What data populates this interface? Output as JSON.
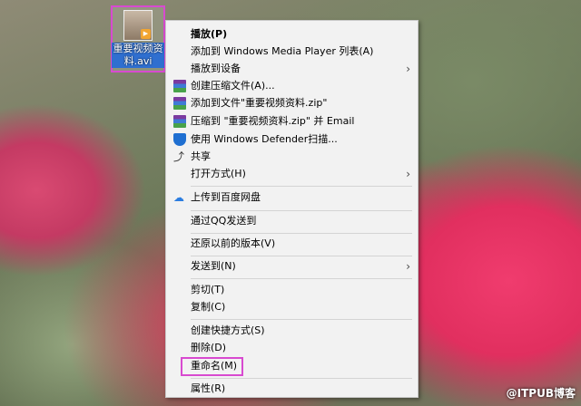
{
  "desktop_file": {
    "label": "重要视频资料.avi"
  },
  "context_menu": {
    "items": [
      {
        "label": "播放(P)"
      },
      {
        "label": "添加到 Windows Media Player 列表(A)"
      },
      {
        "label": "播放到设备"
      },
      {
        "label": "创建压缩文件(A)..."
      },
      {
        "label": "添加到文件\"重要视频资料.zip\""
      },
      {
        "label": "压缩到 \"重要视频资料.zip\" 并 Email"
      },
      {
        "label": "使用 Windows Defender扫描..."
      },
      {
        "label": "共享"
      },
      {
        "label": "打开方式(H)"
      },
      {
        "label": "上传到百度网盘"
      },
      {
        "label": "通过QQ发送到"
      },
      {
        "label": "还原以前的版本(V)"
      },
      {
        "label": "发送到(N)"
      },
      {
        "label": "剪切(T)"
      },
      {
        "label": "复制(C)"
      },
      {
        "label": "创建快捷方式(S)"
      },
      {
        "label": "删除(D)"
      },
      {
        "label": "重命名(M)"
      },
      {
        "label": "属性(R)"
      }
    ]
  },
  "watermark": "@ITPUB博客",
  "colors": {
    "highlight_border": "#d84ad0",
    "menu_bg": "#f2f2f2"
  }
}
